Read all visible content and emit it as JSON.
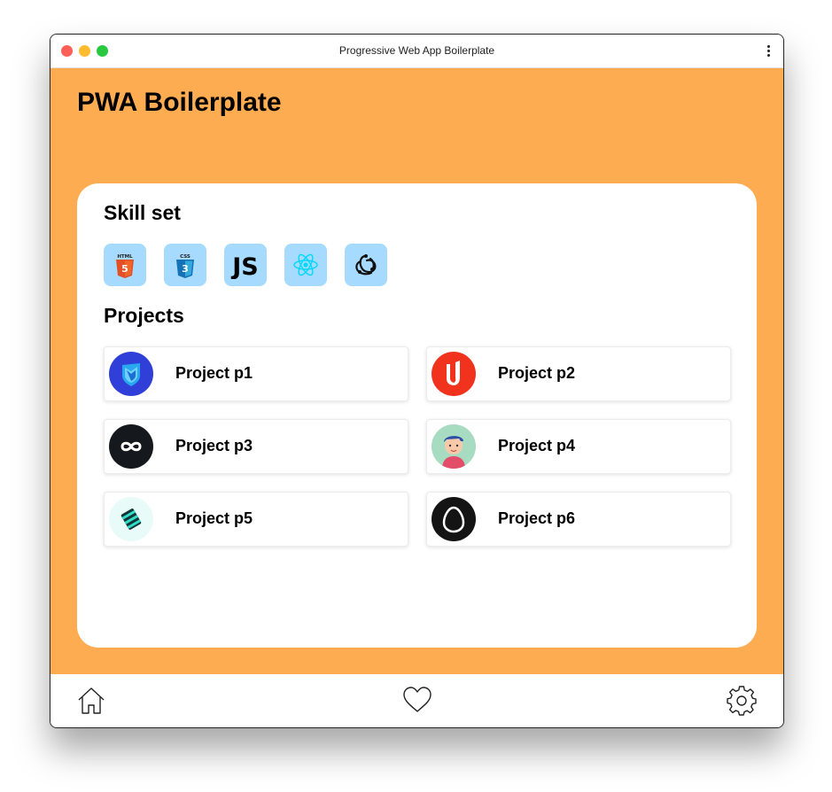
{
  "window": {
    "title": "Progressive Web App Boilerplate"
  },
  "header": {
    "title": "PWA Boilerplate"
  },
  "skills": {
    "title": "Skill set",
    "items": [
      {
        "icon": "html5-icon",
        "label": "HTML5"
      },
      {
        "icon": "css3-icon",
        "label": "CSS3"
      },
      {
        "icon": "javascript-icon",
        "label": "JS"
      },
      {
        "icon": "react-icon",
        "label": "React"
      },
      {
        "icon": "redux-icon",
        "label": "Redux"
      }
    ]
  },
  "projects": {
    "title": "Projects",
    "items": [
      {
        "name": "Project p1",
        "icon": "shield-logo-icon"
      },
      {
        "name": "Project p2",
        "icon": "u-logo-icon"
      },
      {
        "name": "Project p3",
        "icon": "infinity-logo-icon"
      },
      {
        "name": "Project p4",
        "icon": "avatar-logo-icon"
      },
      {
        "name": "Project p5",
        "icon": "stripes-logo-icon"
      },
      {
        "name": "Project p6",
        "icon": "egg-logo-icon"
      }
    ]
  },
  "bottom_nav": [
    {
      "icon": "home-icon",
      "label": "Home"
    },
    {
      "icon": "heart-icon",
      "label": "Favorites"
    },
    {
      "icon": "gear-icon",
      "label": "Settings"
    }
  ],
  "colors": {
    "accent": "#feac51",
    "skill_tile": "#a6daff",
    "card": "#ffffff"
  }
}
